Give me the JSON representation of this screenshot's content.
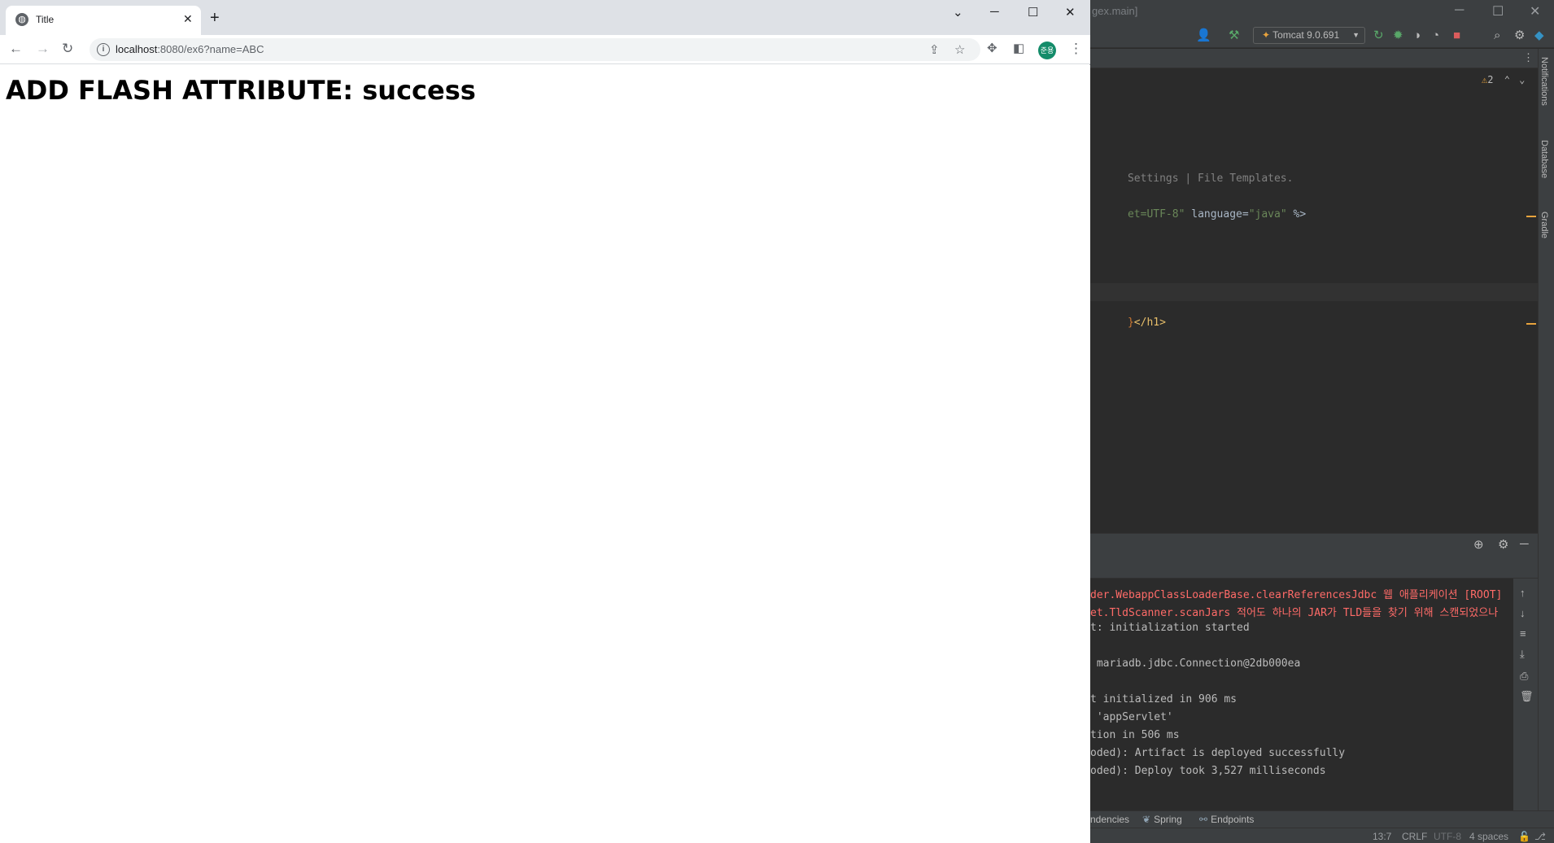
{
  "browser": {
    "tab": {
      "title": "Title",
      "close": "✕"
    },
    "new_tab": "+",
    "window_controls": {
      "tabsearch": "⌄",
      "minimize": "─",
      "maximize": "☐",
      "close": "✕"
    },
    "nav": {
      "back": "←",
      "forward": "→",
      "reload": "↻"
    },
    "url": {
      "host": "localhost",
      "path": ":8080/ex6?name=ABC"
    },
    "avatar_text": "준용",
    "menu": "⋮"
  },
  "page": {
    "heading": "ADD FLASH ATTRIBUTE: success"
  },
  "ide": {
    "title_fragment": "gex.main]",
    "run_config": "Tomcat 9.0.691",
    "warnings_count": "2",
    "right_rail": [
      "Notifications",
      "Database",
      "Gradle"
    ],
    "code": {
      "line1": "Settings | File Templates.",
      "line2": {
        "a": "et=UTF-8\"",
        "b": " language=",
        "c": "\"java\"",
        "d": " %>"
      },
      "line3": {
        "a": "}",
        "b": "</h1>"
      }
    },
    "console": {
      "lines": [
        {
          "text": "der.WebappClassLoaderBase.clearReferencesJdbc 웹 애플리케이션 [ROOT]",
          "error": true
        },
        {
          "text": "et.TldScanner.scanJars 적어도 하나의 JAR가 TLD들을 찾기 위해 스캔되었으나",
          "error": true
        },
        {
          "text": "t: initialization started",
          "error": false
        },
        {
          "text": " mariadb.jdbc.Connection@2db000ea",
          "error": false
        },
        {
          "text": "t initialized in 906 ms",
          "error": false
        },
        {
          "text": " 'appServlet'",
          "error": false
        },
        {
          "text": "tion in 506 ms",
          "error": false
        },
        {
          "text": "oded): Artifact is deployed successfully",
          "error": false
        },
        {
          "text": "oded): Deploy took 3,527 milliseconds",
          "error": false
        }
      ]
    },
    "bottom_tabs": [
      "ndencies",
      "Spring",
      "Endpoints"
    ],
    "status": {
      "position": "13:7",
      "line_sep": "CRLF",
      "encoding": "UTF-8",
      "indent": "4 spaces"
    }
  }
}
